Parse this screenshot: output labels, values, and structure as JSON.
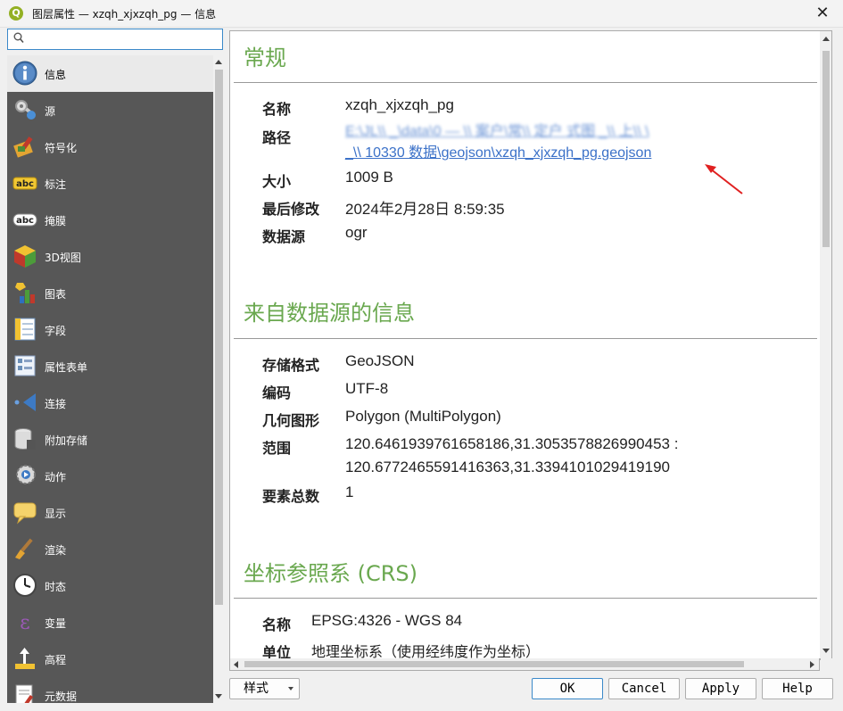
{
  "window": {
    "title": "图层属性 — xzqh_xjxzqh_pg — 信息",
    "app_icon": "qgis-icon",
    "app_icon_letter": "Q",
    "close_glyph": "✕"
  },
  "search": {
    "value": "",
    "placeholder": ""
  },
  "sidebar": {
    "items": [
      {
        "label": "信息",
        "icon": "info-icon",
        "selected": true
      },
      {
        "label": "源",
        "icon": "source-settings-icon"
      },
      {
        "label": "符号化",
        "icon": "symbology-icon"
      },
      {
        "label": "标注",
        "icon": "labels-icon"
      },
      {
        "label": "掩膜",
        "icon": "masks-icon"
      },
      {
        "label": "3D视图",
        "icon": "3d-view-icon"
      },
      {
        "label": "图表",
        "icon": "diagrams-icon"
      },
      {
        "label": "字段",
        "icon": "fields-icon"
      },
      {
        "label": "属性表单",
        "icon": "attributes-form-icon"
      },
      {
        "label": "连接",
        "icon": "joins-icon"
      },
      {
        "label": "附加存储",
        "icon": "auxiliary-storage-icon"
      },
      {
        "label": "动作",
        "icon": "actions-icon"
      },
      {
        "label": "显示",
        "icon": "display-icon"
      },
      {
        "label": "渲染",
        "icon": "rendering-icon"
      },
      {
        "label": "时态",
        "icon": "temporal-icon"
      },
      {
        "label": "变量",
        "icon": "variables-icon"
      },
      {
        "label": "高程",
        "icon": "elevation-icon"
      },
      {
        "label": "元数据",
        "icon": "metadata-icon"
      }
    ]
  },
  "content": {
    "general": {
      "title": "常规",
      "name_key": "名称",
      "name_val": "xzqh_xjxzqh_pg",
      "path_key": "路径",
      "path_line1": "E:\\JL\\\\ _\\data\\0  — \\\\ 案户\\常\\\\ 定户 式图 _\\\\ 上\\\\ \\",
      "path_line2": "_\\\\ 10330 数据\\geojson\\xzqh_xjxzqh_pg.geojson",
      "size_key": "大小",
      "size_val": "1009 B",
      "modified_key": "最后修改",
      "modified_val": "2024年2月28日 8:59:35",
      "provider_key": "数据源",
      "provider_val": "ogr"
    },
    "provider_info": {
      "title": "来自数据源的信息",
      "storage_key": "存储格式",
      "storage_val": "GeoJSON",
      "encoding_key": "编码",
      "encoding_val": "UTF-8",
      "geometry_key": "几何图形",
      "geometry_val": "Polygon (MultiPolygon)",
      "extent_key": "范围",
      "extent_line1": "120.6461939761658186,31.3053578826990453 :",
      "extent_line2": "120.6772465591416363,31.3394101029419190",
      "feature_count_key": "要素总数",
      "feature_count_val": "1"
    },
    "crs": {
      "title": "坐标参照系 (CRS)",
      "name_key": "名称",
      "name_val": "EPSG:4326 - WGS 84",
      "units_key": "单位",
      "units_val": "地理坐标系（使用经纬度作为坐标）"
    }
  },
  "annotation": {
    "color": "#e02020",
    "icon": "red-arrow-annotation"
  },
  "buttons": {
    "style": "样式",
    "ok": "OK",
    "cancel": "Cancel",
    "apply": "Apply",
    "help": "Help"
  },
  "colors": {
    "section_title": "#6aa84f",
    "sidebar_bg": "#575757",
    "link": "#3b71c8"
  }
}
